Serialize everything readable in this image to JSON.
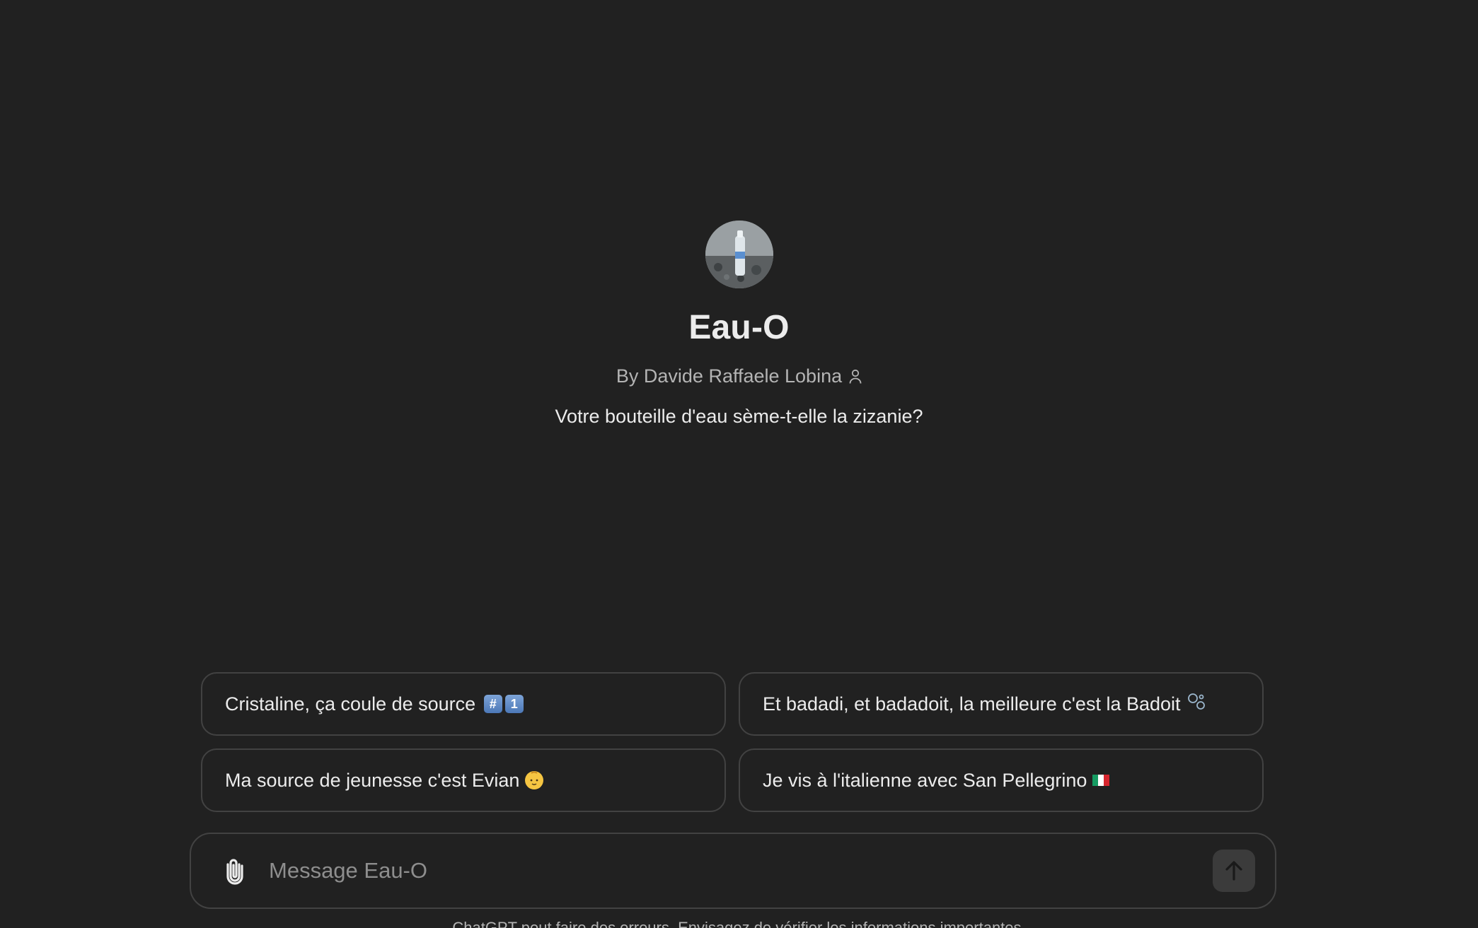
{
  "gpt": {
    "name": "Eau-O",
    "byline": "By Davide Raffaele Lobina",
    "description": "Votre bouteille d'eau sème-t-elle la zizanie?"
  },
  "starters": [
    {
      "label": "Cristaline, ça coule de source",
      "emoji": "hash-one-keycap-icon"
    },
    {
      "label": "Et badadi, et badadoit, la meilleure c'est la Badoit",
      "emoji": "bubbles-icon"
    },
    {
      "label": "Ma source de jeunesse c'est Evian",
      "emoji": "baby-icon"
    },
    {
      "label": "Je vis à l'italienne avec San Pellegrino",
      "emoji": "italy-flag-icon"
    }
  ],
  "composer": {
    "placeholder": "Message Eau-O"
  },
  "footer": {
    "note": "ChatGPT peut faire des erreurs. Envisagez de vérifier les informations importantes."
  },
  "colors": {
    "background": "#212121",
    "border": "#424242",
    "text": "#ececec",
    "muted": "#b4b4b4"
  }
}
